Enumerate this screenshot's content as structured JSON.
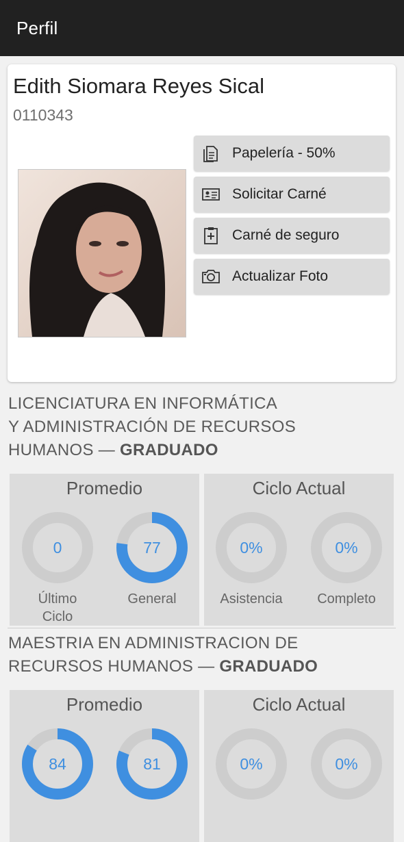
{
  "appbar": {
    "title": "Perfil"
  },
  "profile": {
    "name": "Edith Siomara Reyes Sical",
    "code": "0110343",
    "buttons": [
      {
        "label": "Papelería - 50%",
        "icon": "document-icon"
      },
      {
        "label": "Solicitar Carné",
        "icon": "id-card-icon"
      },
      {
        "label": "Carné de seguro",
        "icon": "clipboard-plus-icon"
      },
      {
        "label": "Actualizar Foto",
        "icon": "camera-icon"
      }
    ]
  },
  "programs": [
    {
      "line1": "LICENCIATURA EN INFORMÁTICA",
      "line2": "Y ADMINISTRACIÓN DE RECURSOS",
      "line3": "HUMANOS — ",
      "status": "GRADUADO",
      "promedio": {
        "title": "Promedio",
        "ultimo": {
          "value": "0",
          "label1": "Último",
          "label2": "Ciclo",
          "fraction": 0
        },
        "general": {
          "value": "77",
          "label": "General",
          "fraction": 0.77
        }
      },
      "ciclo": {
        "title": "Ciclo Actual",
        "asistencia": {
          "value": "0%",
          "label": "Asistencia",
          "fraction": 0
        },
        "completo": {
          "value": "0%",
          "label": "Completo",
          "fraction": 0
        }
      }
    },
    {
      "line1": "MAESTRIA EN ADMINISTRACION DE",
      "line2": "RECURSOS HUMANOS — ",
      "status": "GRADUADO",
      "promedio": {
        "title": "Promedio",
        "ultimo": {
          "value": "84",
          "fraction": 0.84
        },
        "general": {
          "value": "81",
          "fraction": 0.81
        }
      },
      "ciclo": {
        "title": "Ciclo Actual",
        "asistencia": {
          "value": "0%",
          "fraction": 0
        },
        "completo": {
          "value": "0%",
          "fraction": 0
        }
      }
    }
  ],
  "colors": {
    "accent": "#3f8fe0",
    "track": "#cdcdcd",
    "appbar": "#212121"
  }
}
